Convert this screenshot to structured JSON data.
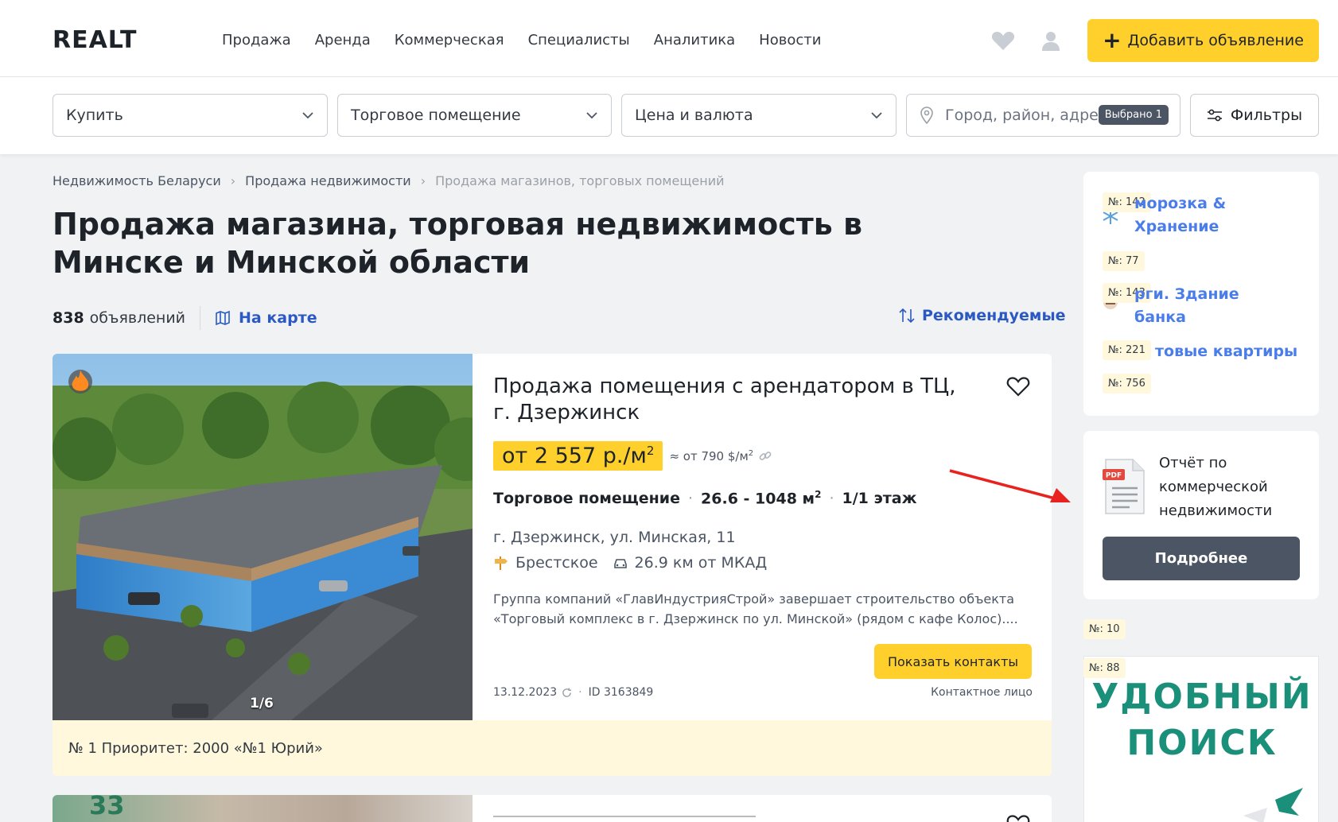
{
  "header": {
    "logo": "REALT",
    "nav": [
      "Продажа",
      "Аренда",
      "Коммерческая",
      "Специалисты",
      "Аналитика",
      "Новости"
    ],
    "add_button": "Добавить объявление"
  },
  "filters": {
    "deal": "Купить",
    "type": "Торговое помещение",
    "price": "Цена и валюта",
    "location_placeholder": "Город, район, адрес",
    "selected_badge": "Выбрано 1",
    "filters_button": "Фильтры"
  },
  "breadcrumbs": [
    "Недвижимость Беларуси",
    "Продажа недвижимости",
    "Продажа магазинов, торговых помещений"
  ],
  "page_title": "Продажа магазина, торговая недвижимость в Минске и Минской области",
  "listing_count": "838",
  "listing_count_label": "объявлений",
  "map_link": "На карте",
  "sort_label": "Рекомендуемые",
  "listing": {
    "title": "Продажа помещения с арендатором в ТЦ, г. Дзержинск",
    "price_prefix": "от 2 557 р./м",
    "price_sup": "2",
    "price_usd_prefix": "≈ от 790 $/м",
    "price_usd_sup": "2",
    "category": "Торговое помещение",
    "area_prefix": "26.6 - 1048 м",
    "area_sup": "2",
    "floor": "1/1 этаж",
    "address": "г. Дзержинск, ул. Минская, 11",
    "direction": "Брестское",
    "distance": "26.9 км от МКАД",
    "description": "Группа компаний «ГлавИндустрияСтрой» завершает строительство объекта «Торговый комплекс в г. Дзержинск по ул. Минской» (рядом с кафе Колос)....",
    "contacts_button": "Показать контакты",
    "date": "13.12.2023",
    "id": "ID 3163849",
    "contact_person": "Контактное лицо",
    "photo_counter": "1/6",
    "priority": "№ 1 Приоритет: 2000 «№1 Юрий»"
  },
  "next_listing": {
    "photo_number": "33"
  },
  "sidebar": {
    "tags": [
      "№: 142",
      "№: 77",
      "№: 143",
      "№: 221",
      "№: 756"
    ],
    "links": [
      "морозка & Хранение",
      "рги. Здание банка",
      "товые квартиры"
    ],
    "report_text": "Отчёт по коммерческой недвижимости",
    "more_button": "Подробнее",
    "tag_10": "№: 10",
    "tag_88": "№: 88",
    "ad_text": "УДОБНЫЙ ПОИСК"
  },
  "colors": {
    "accent_yellow": "#ffd02c",
    "link_blue": "#2a59c4",
    "button_dark": "#4b5563",
    "priority_bg": "#fff8dc",
    "annotation_arrow": "#e8221f"
  }
}
